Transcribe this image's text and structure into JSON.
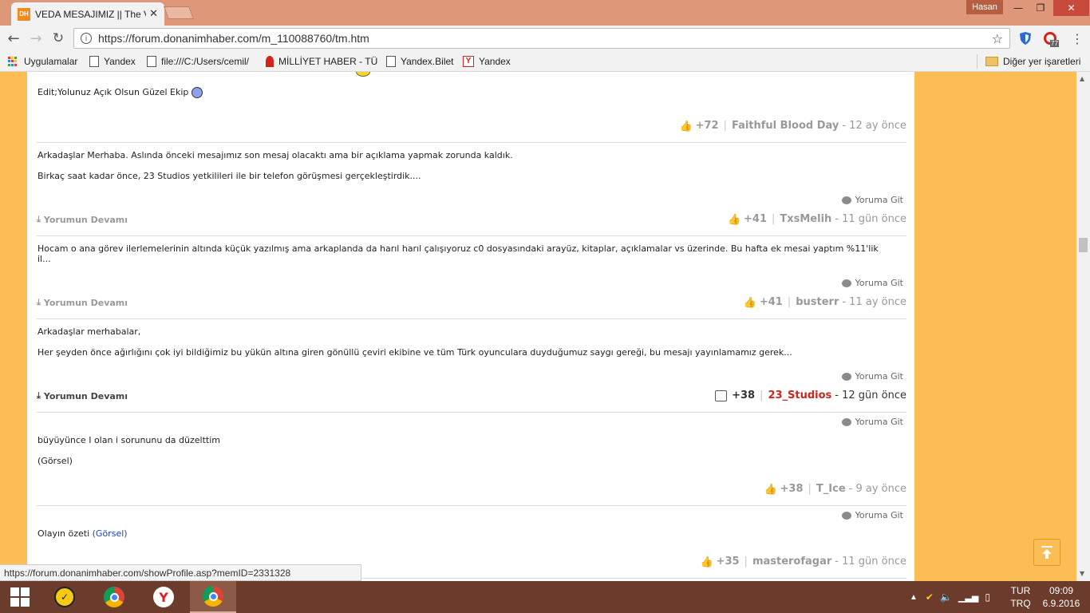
{
  "browser": {
    "tab_title": "VEDA MESAJIMIZ || The V",
    "tab_favicon": "DH",
    "user_name": "Hasan",
    "url": "https://forum.donanimhaber.com/m_110088760/tm.htm",
    "extension_badge": "77"
  },
  "bookmarks": {
    "items": [
      "Uygulamalar",
      "Yandex",
      "file:///C:/Users/cemil/",
      "MİLLİYET HABER - TÜ",
      "Yandex.Bilet",
      "Yandex"
    ],
    "other": "Diğer yer işaretleri"
  },
  "posts": {
    "p0": {
      "text": "Edit;Yolunuz Açık Olsun Güzel Ekip",
      "score": "+72",
      "author": "Faithful Blood Day",
      "ago": "- 12 ay önce"
    },
    "p1": {
      "line1": "Arkadaşlar Merhaba. Aslında önceki mesajımız son mesaj olacaktı ama bir açıklama yapmak zorunda kaldık.",
      "line2": "Birkaç saat kadar önce, 23 Studios yetkilileri ile bir telefon görüşmesi gerçekleştirdik....",
      "reply": "Yoruma Git",
      "more": "Yorumun Devamı",
      "score": "+41",
      "author": "TxsMelih",
      "ago": "- 11 gün önce"
    },
    "p2": {
      "line1": "Hocam o ana görev ilerlemelerinin altında küçük yazılmış ama arkaplanda da harıl harıl çalışıyoruz c0 dosyasındaki arayüz, kitaplar, açıklamalar vs üzerinde. Bu hafta ek mesai yaptım %11'lik il...",
      "reply": "Yoruma Git",
      "more": "Yorumun Devamı",
      "score": "+41",
      "author": "busterr",
      "ago": "- 11 ay önce"
    },
    "p3": {
      "line1": "Arkadaşlar merhabalar,",
      "line2": "Her şeyden önce ağırlığını çok iyi bildiğimiz bu yükün altına giren gönüllü çeviri ekibine ve tüm Türk oyunculara duyduğumuz saygı gereği, bu mesajı yayınlamamız gerek...",
      "reply": "Yoruma Git",
      "more": "Yorumun Devamı",
      "score": "+38",
      "author": "23_Studios",
      "ago": "- 12 gün önce"
    },
    "p4": {
      "reply": "Yoruma Git",
      "line1": "büyüyünce I olan i sorununu da düzelttim",
      "line2": "(Görsel)",
      "score": "+38",
      "author": "T_Ice",
      "ago": "- 9 ay önce"
    },
    "p5": {
      "reply": "Yoruma Git",
      "text": "Olayın özeti",
      "link": "(Görsel)",
      "score": "+35",
      "author": "masterofagar",
      "ago": "- 11 gün önce"
    }
  },
  "status_url": "https://forum.donanimhaber.com/showProfile.asp?memID=2331328",
  "taskbar": {
    "lang_line1": "TUR",
    "lang_line2": "TRQ",
    "time": "09:09",
    "date": "6.9.2016"
  },
  "colors": {
    "page_background": "#fdbd55",
    "title_bar": "#de9779",
    "taskbar": "#6b3c2c",
    "author_highlight": "#d0241c",
    "link": "#1a3cc9"
  }
}
